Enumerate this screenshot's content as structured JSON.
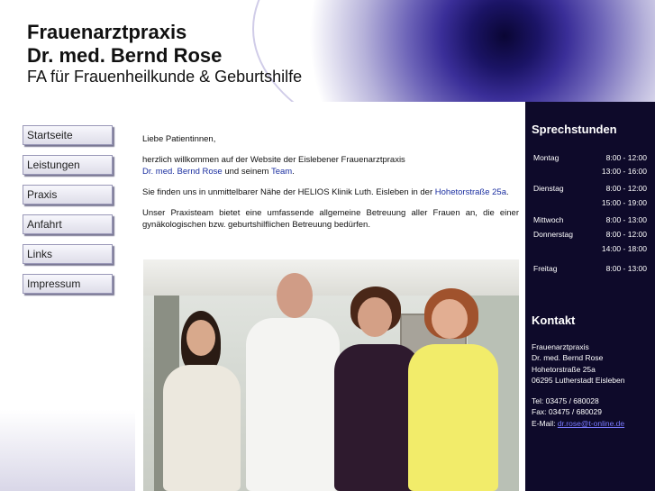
{
  "header": {
    "title_line1": "Frauenarztpraxis",
    "title_line2": "Dr. med. Bernd Rose",
    "subtitle": "FA für Frauenheilkunde & Geburtshilfe"
  },
  "nav": {
    "items": [
      "Startseite",
      "Leistungen",
      "Praxis",
      "Anfahrt",
      "Links",
      "Impressum"
    ]
  },
  "main": {
    "greeting": "Liebe Patientinnen,",
    "welcome_text": "herzlich willkommen auf der Website der Eislebener Frauenarztpraxis",
    "doctor_link": "Dr. med. Bernd Rose",
    "and_team_text": "und seinem",
    "team_link": "Team",
    "team_dot": ".",
    "location_text": "Sie finden uns in unmittelbarer Nähe der HELIOS Klinik Luth. Eisleben in der",
    "street_link": "Hohetorstraße 25a",
    "location_dot": ".",
    "team_paragraph": "Unser Praxisteam bietet eine umfassende allgemeine Betreuung aller Frauen an, die einer gynäkologischen bzw. geburtshilflichen Betreuung bedürfen."
  },
  "sprechstunden": {
    "heading": "Sprechstunden",
    "rows": [
      {
        "day": "Montag",
        "time": "8:00 - 12:00"
      },
      {
        "day": "",
        "time": "13:00 - 16:00"
      },
      {
        "day": "Dienstag",
        "time": "8:00 - 12:00"
      },
      {
        "day": "",
        "time": "15:00 - 19:00"
      },
      {
        "day": "Mittwoch",
        "time": "8:00 - 13:00"
      },
      {
        "day": "Donnerstag",
        "time": "8:00 - 12:00"
      },
      {
        "day": "",
        "time": "14:00 - 18:00"
      },
      {
        "day": "Freitag",
        "time": "8:00 - 13:00"
      }
    ]
  },
  "kontakt": {
    "heading": "Kontakt",
    "name": "Frauenarztpraxis",
    "doctor": "Dr. med. Bernd Rose",
    "street": "Hohetorstraße 25a",
    "city": "06295 Lutherstadt Eisleben",
    "tel": "Tel: 03475 / 680028",
    "fax": "Fax: 03475 / 680029",
    "email_label": "E-Mail:",
    "email_link": "dr.rose@t-online.de"
  },
  "colors": {
    "right_panel_bg": "#0e0a2a",
    "link": "#1a2ea0",
    "header_gradient_dark": "#1b1466"
  }
}
